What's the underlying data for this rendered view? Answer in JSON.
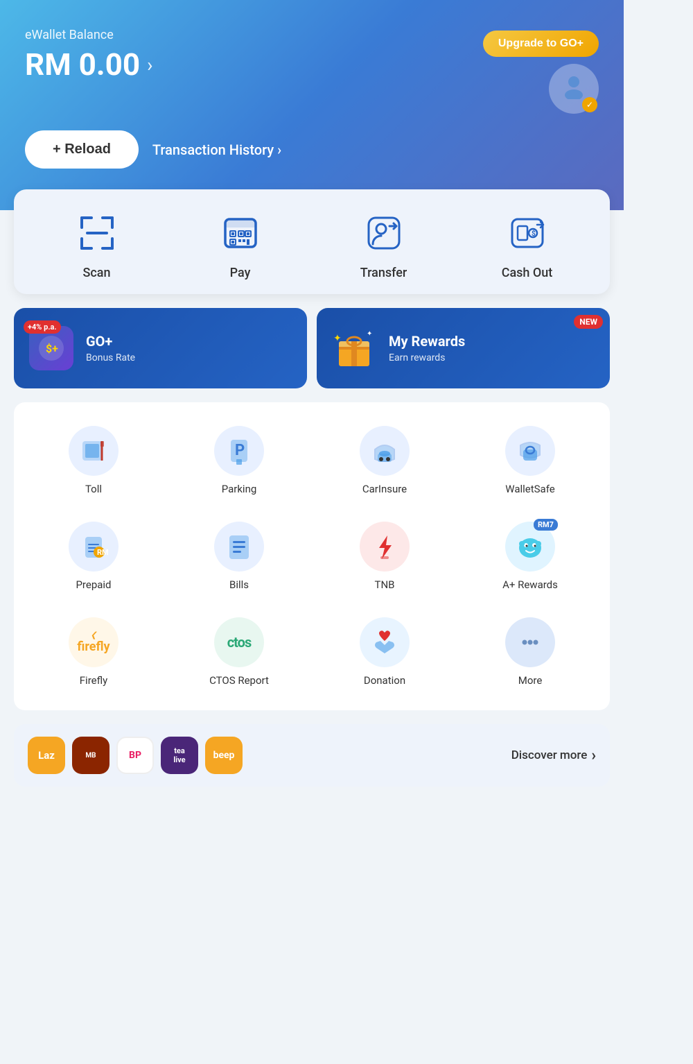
{
  "header": {
    "balance_label": "eWallet Balance",
    "upgrade_btn": "Upgrade to GO+",
    "balance_amount": "RM 0.00",
    "balance_arrow": ">",
    "reload_btn": "+ Reload",
    "transaction_history": "Transaction History",
    "transaction_arrow": ">"
  },
  "quick_actions": [
    {
      "id": "scan",
      "label": "Scan"
    },
    {
      "id": "pay",
      "label": "Pay"
    },
    {
      "id": "transfer",
      "label": "Transfer"
    },
    {
      "id": "cashout",
      "label": "Cash Out"
    }
  ],
  "promo_cards": [
    {
      "id": "go-plus",
      "badge": "+4% p.a.",
      "title": "GO+",
      "subtitle": "Bonus Rate",
      "new_label": null
    },
    {
      "id": "my-rewards",
      "title": "My Rewards",
      "subtitle": "Earn rewards",
      "new_label": "NEW"
    }
  ],
  "services_row1": [
    {
      "id": "toll",
      "label": "Toll"
    },
    {
      "id": "parking",
      "label": "Parking"
    },
    {
      "id": "carinsure",
      "label": "CarInsure"
    },
    {
      "id": "walletsafe",
      "label": "WalletSafe"
    }
  ],
  "services_row2": [
    {
      "id": "prepaid",
      "label": "Prepaid"
    },
    {
      "id": "bills",
      "label": "Bills"
    },
    {
      "id": "tnb",
      "label": "TNB"
    },
    {
      "id": "arewards",
      "label": "A+ Rewards",
      "badge": "RM7"
    }
  ],
  "services_row3": [
    {
      "id": "firefly",
      "label": "Firefly"
    },
    {
      "id": "ctos",
      "label": "CTOS Report"
    },
    {
      "id": "donation",
      "label": "Donation"
    },
    {
      "id": "more",
      "label": "More"
    }
  ],
  "discovery": {
    "label": "Discover more",
    "arrow": "›",
    "partners": [
      {
        "id": "lazada",
        "bg": "#f5a623",
        "text": "Laz",
        "color": "#fff"
      },
      {
        "id": "marrybrown",
        "bg": "#c8102e",
        "text": "MB",
        "color": "#fff"
      },
      {
        "id": "bp",
        "bg": "#fff",
        "text": "BP",
        "color": "#e91e63"
      },
      {
        "id": "tealive",
        "bg": "#5b2d8e",
        "text": "tea live",
        "color": "#fff"
      },
      {
        "id": "beep",
        "bg": "#f5a623",
        "text": "beep",
        "color": "#fff"
      }
    ]
  }
}
